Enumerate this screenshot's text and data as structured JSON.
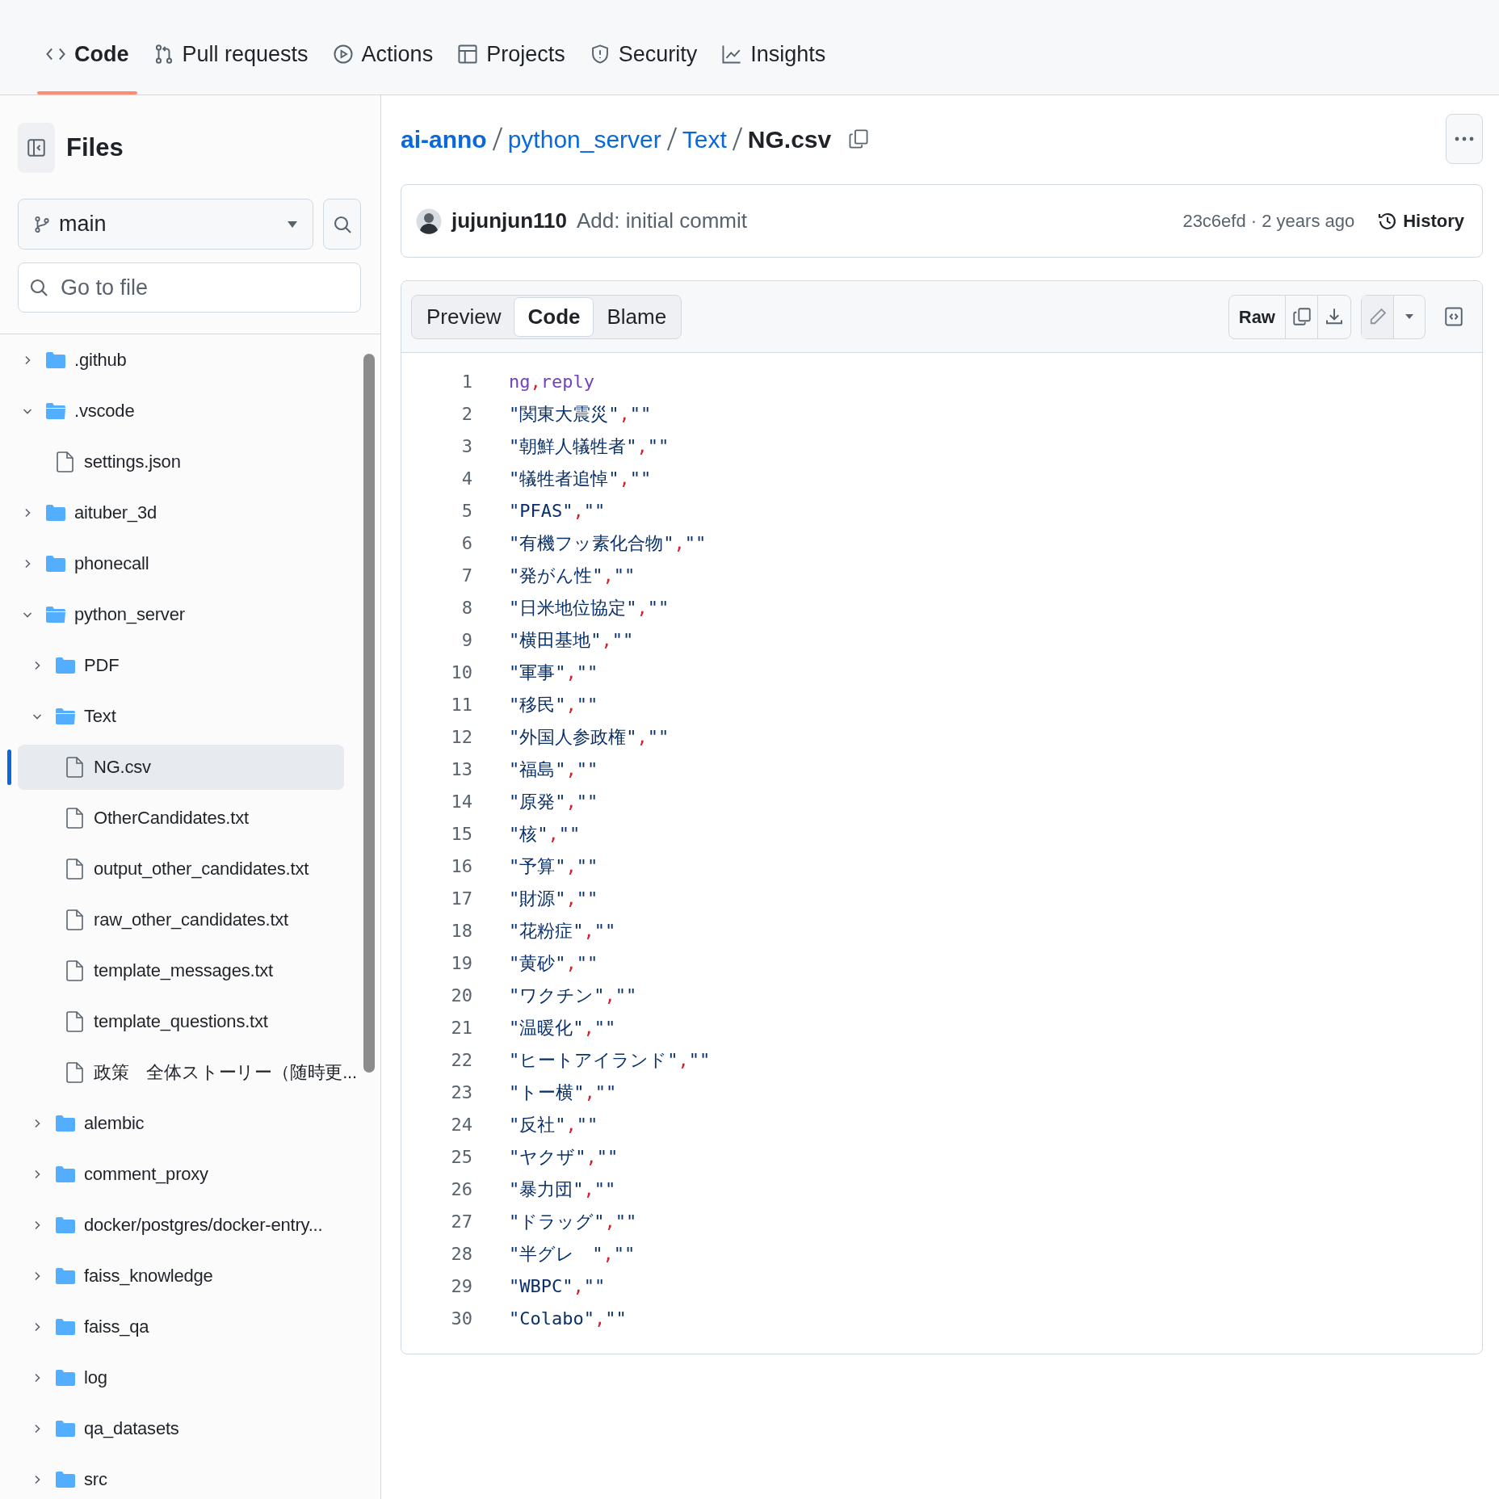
{
  "repo_tabs": [
    {
      "label": "Code",
      "selected": true
    },
    {
      "label": "Pull requests",
      "selected": false
    },
    {
      "label": "Actions",
      "selected": false
    },
    {
      "label": "Projects",
      "selected": false
    },
    {
      "label": "Security",
      "selected": false
    },
    {
      "label": "Insights",
      "selected": false
    }
  ],
  "sidebar": {
    "title": "Files",
    "branch": "main",
    "search_placeholder": "Go to file",
    "tree": [
      {
        "label": ".github",
        "kind": "folder",
        "expanded": false,
        "selected": false
      },
      {
        "label": ".vscode",
        "kind": "folder",
        "expanded": true,
        "selected": false,
        "children": [
          {
            "label": "settings.json",
            "kind": "file",
            "selected": false
          }
        ]
      },
      {
        "label": "aituber_3d",
        "kind": "folder",
        "expanded": false,
        "selected": false
      },
      {
        "label": "phonecall",
        "kind": "folder",
        "expanded": false,
        "selected": false
      },
      {
        "label": "python_server",
        "kind": "folder",
        "expanded": true,
        "selected": false,
        "children": [
          {
            "label": "PDF",
            "kind": "folder",
            "expanded": false,
            "selected": false
          },
          {
            "label": "Text",
            "kind": "folder",
            "expanded": true,
            "selected": false,
            "children": [
              {
                "label": "NG.csv",
                "kind": "file",
                "selected": true
              },
              {
                "label": "OtherCandidates.txt",
                "kind": "file",
                "selected": false
              },
              {
                "label": "output_other_candidates.txt",
                "kind": "file",
                "selected": false
              },
              {
                "label": "raw_other_candidates.txt",
                "kind": "file",
                "selected": false
              },
              {
                "label": "template_messages.txt",
                "kind": "file",
                "selected": false
              },
              {
                "label": "template_questions.txt",
                "kind": "file",
                "selected": false
              },
              {
                "label": "政策　全体ストーリー（随時更...",
                "kind": "file",
                "selected": false
              }
            ]
          },
          {
            "label": "alembic",
            "kind": "folder",
            "expanded": false,
            "selected": false
          },
          {
            "label": "comment_proxy",
            "kind": "folder",
            "expanded": false,
            "selected": false
          },
          {
            "label": "docker/postgres/docker-entry...",
            "kind": "folder",
            "expanded": false,
            "selected": false
          },
          {
            "label": "faiss_knowledge",
            "kind": "folder",
            "expanded": false,
            "selected": false
          },
          {
            "label": "faiss_qa",
            "kind": "folder",
            "expanded": false,
            "selected": false
          },
          {
            "label": "log",
            "kind": "folder",
            "expanded": false,
            "selected": false
          },
          {
            "label": "qa_datasets",
            "kind": "folder",
            "expanded": false,
            "selected": false
          },
          {
            "label": "src",
            "kind": "folder",
            "expanded": false,
            "selected": false
          }
        ]
      }
    ]
  },
  "breadcrumb": [
    "ai-anno",
    "python_server",
    "Text"
  ],
  "file_name": "NG.csv",
  "commit": {
    "author": "jujunjun110",
    "message": "Add: initial commit",
    "sha_time": "23c6efd · 2 years ago",
    "history": "History"
  },
  "view_tabs": [
    {
      "label": "Preview",
      "selected": false
    },
    {
      "label": "Code",
      "selected": true
    },
    {
      "label": "Blame",
      "selected": false
    }
  ],
  "raw_button": "Raw",
  "delimiter": ",",
  "lines": [
    {
      "number": "1",
      "kind": "header",
      "cells": [
        "ng",
        "reply"
      ]
    },
    {
      "number": "2",
      "kind": "row",
      "cells": [
        "\"関東大震災\"",
        "\"\""
      ]
    },
    {
      "number": "3",
      "kind": "row",
      "cells": [
        "\"朝鮮人犠牲者\"",
        "\"\""
      ]
    },
    {
      "number": "4",
      "kind": "row",
      "cells": [
        "\"犠牲者追悼\"",
        "\"\""
      ]
    },
    {
      "number": "5",
      "kind": "row",
      "cells": [
        "\"PFAS\"",
        "\"\""
      ]
    },
    {
      "number": "6",
      "kind": "row",
      "cells": [
        "\"有機フッ素化合物\"",
        "\"\""
      ]
    },
    {
      "number": "7",
      "kind": "row",
      "cells": [
        "\"発がん性\"",
        "\"\""
      ]
    },
    {
      "number": "8",
      "kind": "row",
      "cells": [
        "\"日米地位協定\"",
        "\"\""
      ]
    },
    {
      "number": "9",
      "kind": "row",
      "cells": [
        "\"横田基地\"",
        "\"\""
      ]
    },
    {
      "number": "10",
      "kind": "row",
      "cells": [
        "\"軍事\"",
        "\"\""
      ]
    },
    {
      "number": "11",
      "kind": "row",
      "cells": [
        "\"移民\"",
        "\"\""
      ]
    },
    {
      "number": "12",
      "kind": "row",
      "cells": [
        "\"外国人参政権\"",
        "\"\""
      ]
    },
    {
      "number": "13",
      "kind": "row",
      "cells": [
        "\"福島\"",
        "\"\""
      ]
    },
    {
      "number": "14",
      "kind": "row",
      "cells": [
        "\"原発\"",
        "\"\""
      ]
    },
    {
      "number": "15",
      "kind": "row",
      "cells": [
        "\"核\"",
        "\"\""
      ]
    },
    {
      "number": "16",
      "kind": "row",
      "cells": [
        "\"予算\"",
        "\"\""
      ]
    },
    {
      "number": "17",
      "kind": "row",
      "cells": [
        "\"財源\"",
        "\"\""
      ]
    },
    {
      "number": "18",
      "kind": "row",
      "cells": [
        "\"花粉症\"",
        "\"\""
      ]
    },
    {
      "number": "19",
      "kind": "row",
      "cells": [
        "\"黄砂\"",
        "\"\""
      ]
    },
    {
      "number": "20",
      "kind": "row",
      "cells": [
        "\"ワクチン\"",
        "\"\""
      ]
    },
    {
      "number": "21",
      "kind": "row",
      "cells": [
        "\"温暖化\"",
        "\"\""
      ]
    },
    {
      "number": "22",
      "kind": "row",
      "cells": [
        "\"ヒートアイランド\"",
        "\"\""
      ]
    },
    {
      "number": "23",
      "kind": "row",
      "cells": [
        "\"トー横\"",
        "\"\""
      ]
    },
    {
      "number": "24",
      "kind": "row",
      "cells": [
        "\"反社\"",
        "\"\""
      ]
    },
    {
      "number": "25",
      "kind": "row",
      "cells": [
        "\"ヤクザ\"",
        "\"\""
      ]
    },
    {
      "number": "26",
      "kind": "row",
      "cells": [
        "\"暴力団\"",
        "\"\""
      ]
    },
    {
      "number": "27",
      "kind": "row",
      "cells": [
        "\"ドラッグ\"",
        "\"\""
      ]
    },
    {
      "number": "28",
      "kind": "row",
      "cells": [
        "\"半グレ　\"",
        "\"\""
      ]
    },
    {
      "number": "29",
      "kind": "row",
      "cells": [
        "\"WBPC\"",
        "\"\""
      ]
    },
    {
      "number": "30",
      "kind": "row",
      "cells": [
        "\"Colabo\"",
        "\"\""
      ]
    }
  ]
}
